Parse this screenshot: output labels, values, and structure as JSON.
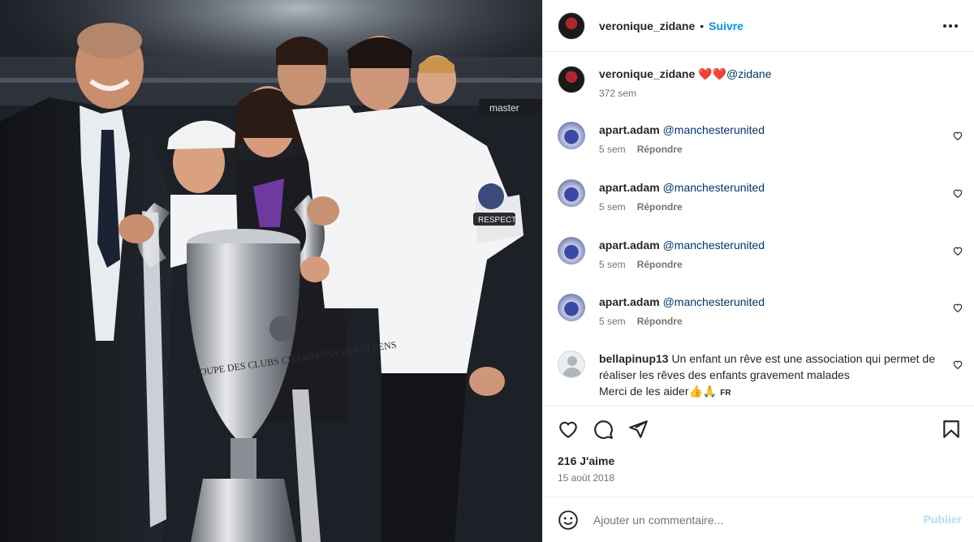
{
  "post": {
    "author": "veronique_zidane",
    "follow_label": "Suivre",
    "dot": "•"
  },
  "caption": {
    "username": "veronique_zidane",
    "hearts": "❤️❤️",
    "mention": "@zidane",
    "time": "372 sem"
  },
  "comments": [
    {
      "username": "apart.adam",
      "mention": "@manchesterunited",
      "time": "5 sem",
      "reply": "Répondre"
    },
    {
      "username": "apart.adam",
      "mention": "@manchesterunited",
      "time": "5 sem",
      "reply": "Répondre"
    },
    {
      "username": "apart.adam",
      "mention": "@manchesterunited",
      "time": "5 sem",
      "reply": "Répondre"
    },
    {
      "username": "apart.adam",
      "mention": "@manchesterunited",
      "time": "5 sem",
      "reply": "Répondre"
    },
    {
      "username": "bellapinup13",
      "text": "Un enfant un rêve est une association qui permet de réaliser les rêves des enfants gravement malades",
      "text2": "Merci de les aider👍🙏",
      "flag": "FR"
    }
  ],
  "stats": {
    "likes": "216 J'aime",
    "date": "15 août 2018"
  },
  "composer": {
    "placeholder": "Ajouter un commentaire...",
    "publish_label": "Publier"
  },
  "photo": {
    "trophy_text": "COUPE DES CLUBS CHAMPIONS EUROPÉENS",
    "sponsor": "master",
    "respect": "RESPECT"
  },
  "colors": {
    "link": "#0095f6",
    "mention": "#00376b",
    "muted": "#737373",
    "publish_disabled": "#b2dffc"
  }
}
